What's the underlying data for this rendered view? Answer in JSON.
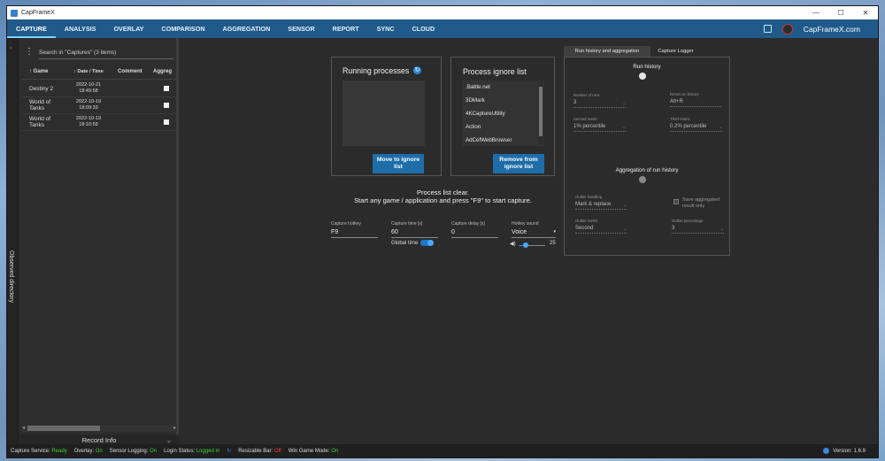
{
  "window": {
    "title": "CapFrameX",
    "minimize": "—",
    "maximize": "☐",
    "close": "✕"
  },
  "menu": {
    "items": [
      "CAPTURE",
      "ANALYSIS",
      "OVERLAY",
      "COMPARISON",
      "AGGREGATION",
      "SENSOR",
      "REPORT",
      "SYNC",
      "CLOUD"
    ],
    "active": "CAPTURE",
    "brand": "CapFrameX.com"
  },
  "observed_directory": {
    "label": "Observed directory"
  },
  "captures": {
    "search_placeholder": "Search in \"Captures\" (3 items)",
    "columns": [
      "Game",
      "Date / Time",
      "Comment",
      "Aggreg"
    ],
    "rows": [
      {
        "game": "Destiny 2",
        "date": "2022-10-21",
        "time": "18:49:58",
        "comment": ""
      },
      {
        "game": "World of Tanks",
        "date": "2022-10-19",
        "time": "18:09:33",
        "comment": ""
      },
      {
        "game": "World of Tanks",
        "date": "2022-10-19",
        "time": "18:10:59",
        "comment": ""
      }
    ]
  },
  "record_info": {
    "label": "Record Info"
  },
  "running": {
    "title": "Running processes",
    "button": "Move to ignore list"
  },
  "ignore": {
    "title": "Process ignore list",
    "items": [
      ".Battle.net",
      "3DMark",
      "4KCaptureUtility",
      "Action",
      "AdCefWebBrowser"
    ],
    "button": "Remove from ignore list"
  },
  "message": {
    "line1": "Process list clear.",
    "line2": "Start any game / application and press \"F9\" to start capture."
  },
  "settings": {
    "capture_hotkey": {
      "label": "Capture hotkey",
      "value": "F9"
    },
    "capture_time": {
      "label": "Capture time [s]",
      "value": "60"
    },
    "capture_delay": {
      "label": "Capture delay [s]",
      "value": "0"
    },
    "hotkey_sound": {
      "label": "Hotkey sound",
      "value": "Voice"
    },
    "global_time": {
      "label": "Global time",
      "on": true
    },
    "volume": {
      "value": "25",
      "level": 0.25
    }
  },
  "right_tabs": {
    "active": "Run history and aggregation",
    "other": "Capture Logger"
  },
  "run_history": {
    "title": "Run history",
    "number_of_runs": {
      "label": "Number of runs",
      "value": "3"
    },
    "reset_hotkey": {
      "label": "Reset run history",
      "value": "Alt+R"
    },
    "second_metric": {
      "label": "Second metric",
      "value": "1% percentile"
    },
    "third_metric": {
      "label": "Third metric",
      "value": "0.2% percentile"
    }
  },
  "aggregation": {
    "title": "Aggregation of run history",
    "outlier_handling": {
      "label": "Outlier handling",
      "value": "Mark & replace"
    },
    "save_aggregated": {
      "label": "Save aggregated result only"
    },
    "outlier_metric": {
      "label": "Outlier metric",
      "value": "Second"
    },
    "outlier_percentage": {
      "label": "Outlier percentage",
      "value": "3"
    }
  },
  "status": {
    "capture_service": {
      "label": "Capture Service:",
      "value": "Ready"
    },
    "overlay": {
      "label": "Overlay:",
      "value": "On"
    },
    "sensor_logging": {
      "label": "Sensor Logging:",
      "value": "On"
    },
    "login_status": {
      "label": "Login Status:",
      "value": "Logged in"
    },
    "resizable_bar": {
      "label": "Resizable Bar:",
      "value": "Off"
    },
    "win_game_mode": {
      "label": "Win Game Mode:",
      "value": "On"
    },
    "version": "Version: 1.6.9"
  },
  "colors": {
    "accent": "#1f6da8",
    "menubar": "#1f5a8a",
    "ok": "#3cd33c",
    "bad": "#ff3b3b"
  }
}
